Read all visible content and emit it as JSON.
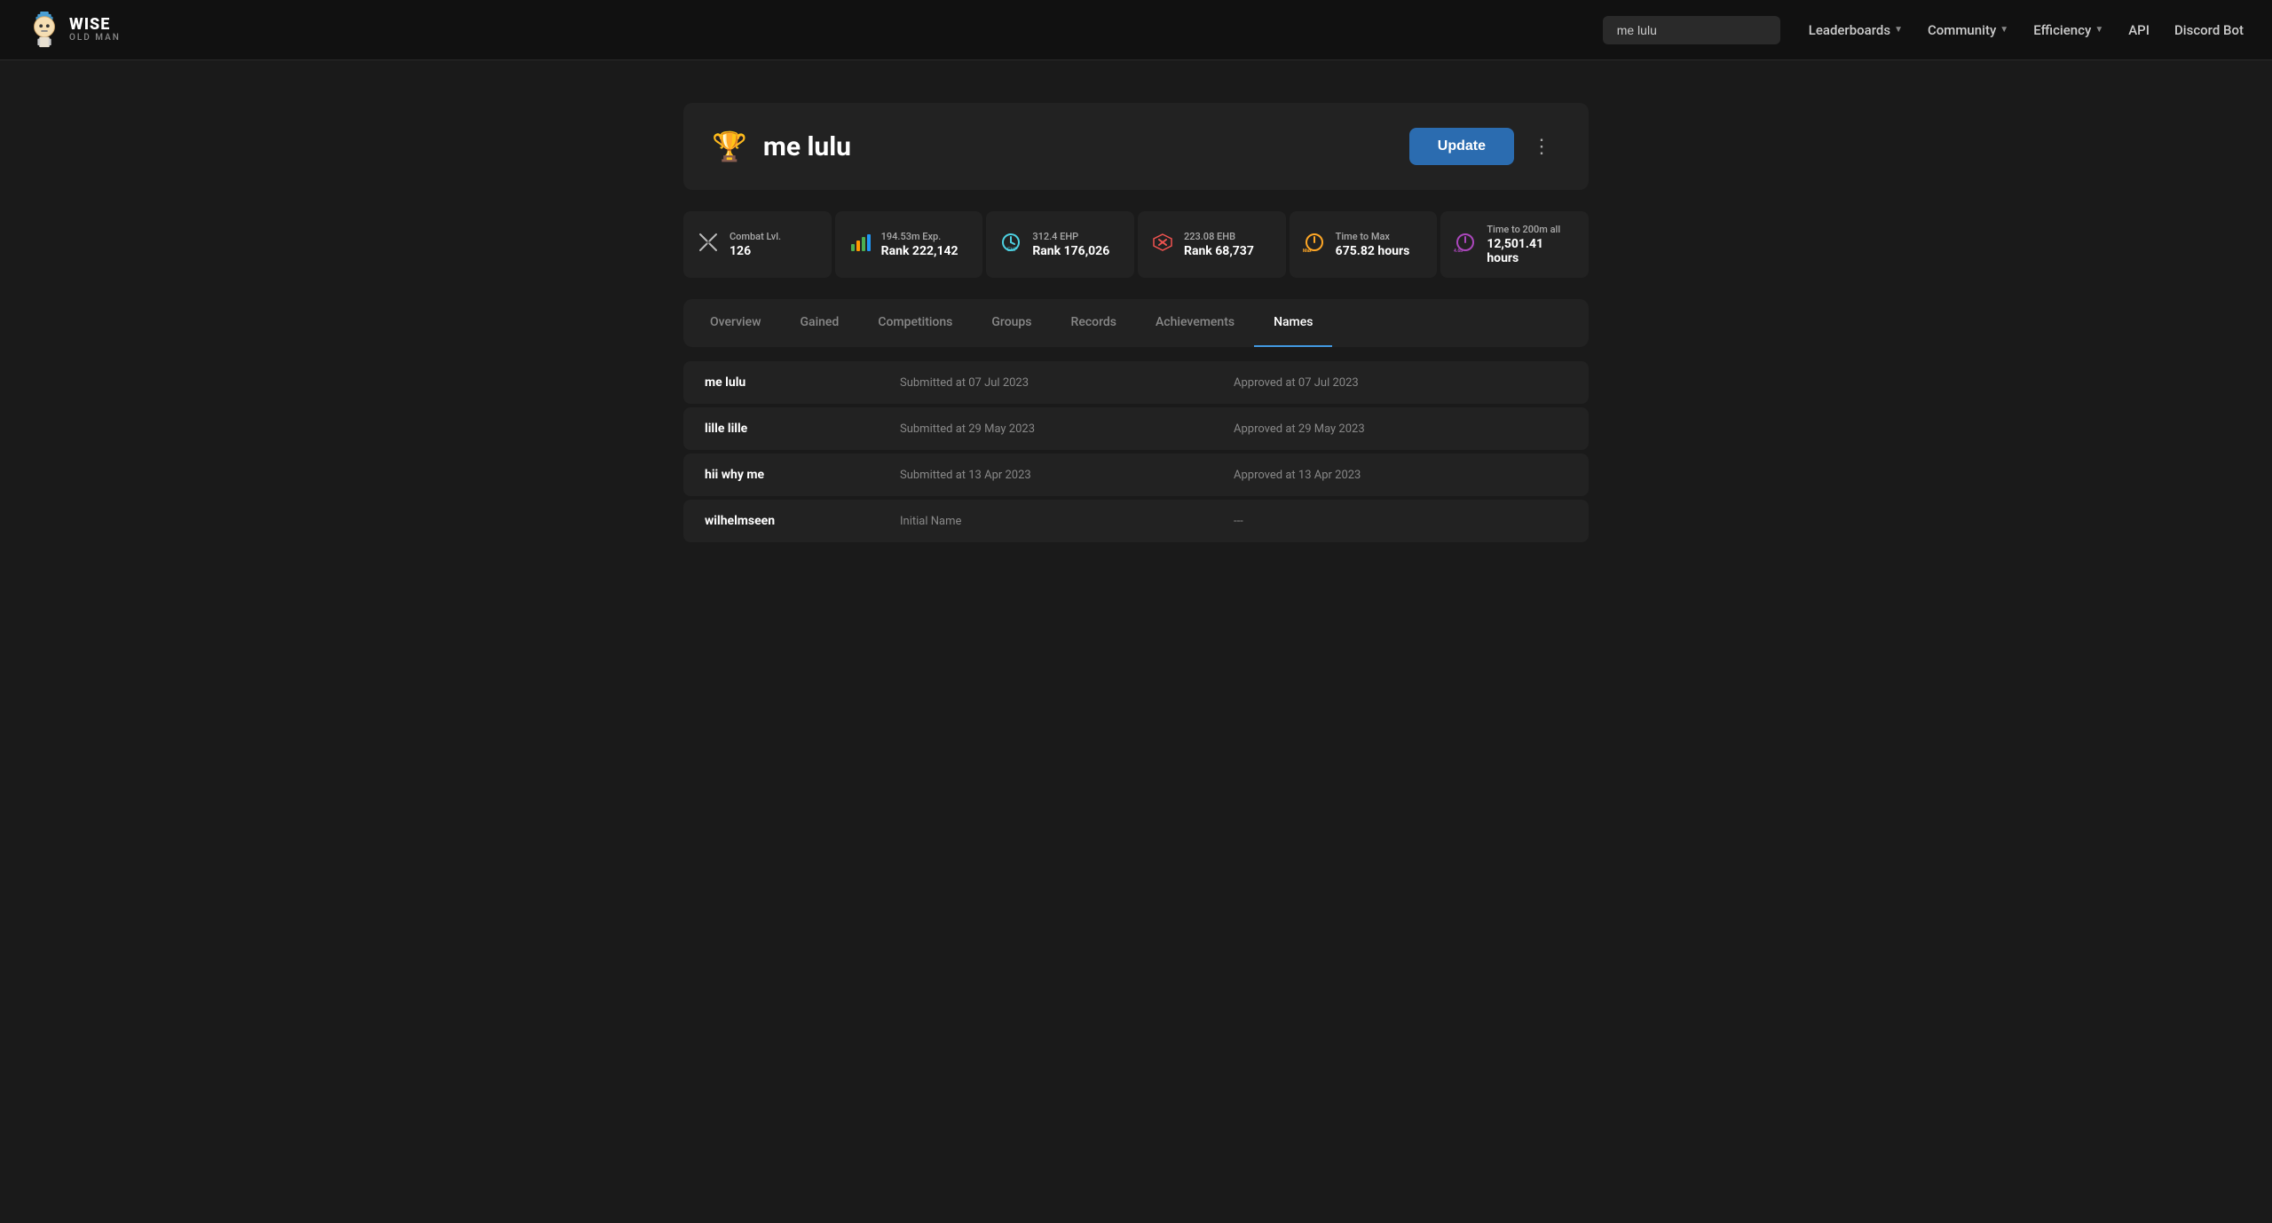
{
  "site": {
    "logo_title": "WISE",
    "logo_sub": "OLD MAN"
  },
  "navbar": {
    "search_placeholder": "me lulu",
    "search_value": "me lulu",
    "links": [
      {
        "label": "Leaderboards",
        "has_dropdown": true
      },
      {
        "label": "Community",
        "has_dropdown": true
      },
      {
        "label": "Efficiency",
        "has_dropdown": true
      },
      {
        "label": "API",
        "has_dropdown": false
      },
      {
        "label": "Discord Bot",
        "has_dropdown": false
      }
    ]
  },
  "player": {
    "name": "me lulu",
    "trophy_icon": "🏆",
    "update_button": "Update",
    "more_icon": "⋮"
  },
  "stats": [
    {
      "icon": "⚔",
      "label": "Combat Lvl.",
      "value": "126",
      "sub": null,
      "icon_class": "icon-swords"
    },
    {
      "icon": "📊",
      "label": "194.53m Exp.",
      "value": "Rank 222,142",
      "sub": null,
      "icon_class": "icon-chart"
    },
    {
      "icon": "⏱",
      "label": "312.4 EHP",
      "value": "Rank 176,026",
      "sub": null,
      "icon_class": "icon-ehp"
    },
    {
      "icon": "🗡",
      "label": "223.08 EHB",
      "value": "Rank 68,737",
      "sub": null,
      "icon_class": "icon-ehb"
    },
    {
      "icon": "⏳",
      "label": "Time to Max",
      "value": "675.82 hours",
      "sub": null,
      "icon_class": "icon-max"
    },
    {
      "icon": "⌛",
      "label": "Time to 200m all",
      "value": "12,501.41 hours",
      "sub": null,
      "icon_class": "icon-200m"
    }
  ],
  "tabs": [
    {
      "label": "Overview",
      "active": false
    },
    {
      "label": "Gained",
      "active": false
    },
    {
      "label": "Competitions",
      "active": false
    },
    {
      "label": "Groups",
      "active": false
    },
    {
      "label": "Records",
      "active": false
    },
    {
      "label": "Achievements",
      "active": false
    },
    {
      "label": "Names",
      "active": true
    }
  ],
  "names": [
    {
      "name": "me lulu",
      "submitted": "Submitted at 07 Jul 2023",
      "approved": "Approved at 07 Jul 2023"
    },
    {
      "name": "lille lille",
      "submitted": "Submitted at 29 May 2023",
      "approved": "Approved at 29 May 2023"
    },
    {
      "name": "hii why me",
      "submitted": "Submitted at 13 Apr 2023",
      "approved": "Approved at 13 Apr 2023"
    },
    {
      "name": "wilhelmseen",
      "submitted": "Initial Name",
      "approved": "---"
    }
  ]
}
